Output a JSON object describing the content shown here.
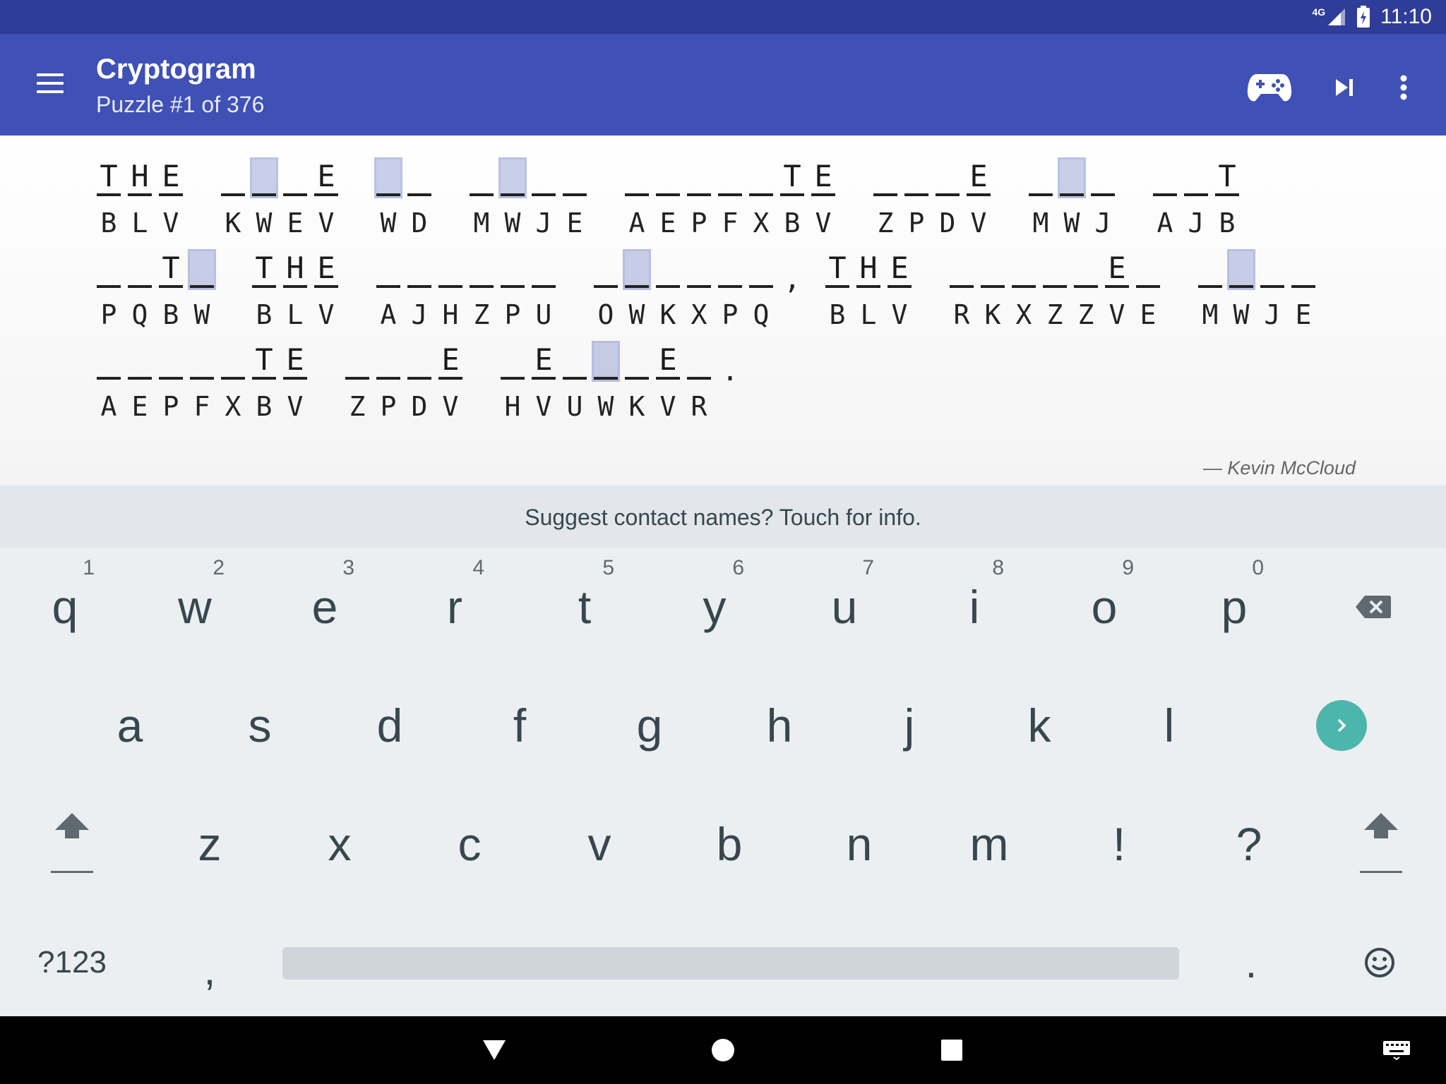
{
  "status": {
    "network": "4G",
    "time": "11:10"
  },
  "appbar": {
    "title": "Cryptogram",
    "subtitle": "Puzzle #1 of 376"
  },
  "puzzle": {
    "lines": [
      [
        {
          "cells": [
            {
              "g": "T",
              "c": "B"
            },
            {
              "g": "H",
              "c": "L"
            },
            {
              "g": "E",
              "c": "V"
            }
          ]
        },
        {
          "cells": [
            {
              "g": "",
              "c": "K"
            },
            {
              "g": "",
              "c": "W",
              "sel": true
            },
            {
              "g": "",
              "c": "E"
            },
            {
              "g": "E",
              "c": "V"
            }
          ]
        },
        {
          "cells": [
            {
              "g": "",
              "c": "W",
              "sel": true
            },
            {
              "g": "",
              "c": "D"
            }
          ]
        },
        {
          "cells": [
            {
              "g": "",
              "c": "M"
            },
            {
              "g": "",
              "c": "W",
              "sel": true
            },
            {
              "g": "",
              "c": "J"
            },
            {
              "g": "",
              "c": "E"
            }
          ]
        },
        {
          "cells": [
            {
              "g": "",
              "c": "A"
            },
            {
              "g": "",
              "c": "E"
            },
            {
              "g": "",
              "c": "P"
            },
            {
              "g": "",
              "c": "F"
            },
            {
              "g": "",
              "c": "X"
            },
            {
              "g": "T",
              "c": "B"
            },
            {
              "g": "E",
              "c": "V"
            }
          ]
        },
        {
          "cells": [
            {
              "g": "",
              "c": "Z"
            },
            {
              "g": "",
              "c": "P"
            },
            {
              "g": "",
              "c": "D"
            },
            {
              "g": "E",
              "c": "V"
            }
          ]
        },
        {
          "cells": [
            {
              "g": "",
              "c": "M"
            },
            {
              "g": "",
              "c": "W",
              "sel": true
            },
            {
              "g": "",
              "c": "J"
            }
          ]
        },
        {
          "cells": [
            {
              "g": "",
              "c": "A"
            },
            {
              "g": "",
              "c": "J"
            },
            {
              "g": "T",
              "c": "B"
            }
          ]
        }
      ],
      [
        {
          "cells": [
            {
              "g": "",
              "c": "P"
            },
            {
              "g": "",
              "c": "Q"
            },
            {
              "g": "T",
              "c": "B"
            },
            {
              "g": "",
              "c": "W",
              "sel": true
            }
          ]
        },
        {
          "cells": [
            {
              "g": "T",
              "c": "B"
            },
            {
              "g": "H",
              "c": "L"
            },
            {
              "g": "E",
              "c": "V"
            }
          ]
        },
        {
          "cells": [
            {
              "g": "",
              "c": "A"
            },
            {
              "g": "",
              "c": "J"
            },
            {
              "g": "",
              "c": "H"
            },
            {
              "g": "",
              "c": "Z"
            },
            {
              "g": "",
              "c": "P"
            },
            {
              "g": "",
              "c": "U"
            }
          ]
        },
        {
          "cells": [
            {
              "g": "",
              "c": "O"
            },
            {
              "g": "",
              "c": "W",
              "sel": true
            },
            {
              "g": "",
              "c": "K"
            },
            {
              "g": "",
              "c": "X"
            },
            {
              "g": "",
              "c": "P"
            },
            {
              "g": "",
              "c": "Q"
            }
          ],
          "punct": ","
        },
        {
          "cells": [
            {
              "g": "T",
              "c": "B"
            },
            {
              "g": "H",
              "c": "L"
            },
            {
              "g": "E",
              "c": "V"
            }
          ]
        },
        {
          "cells": [
            {
              "g": "",
              "c": "R"
            },
            {
              "g": "",
              "c": "K"
            },
            {
              "g": "",
              "c": "X"
            },
            {
              "g": "",
              "c": "Z"
            },
            {
              "g": "",
              "c": "Z"
            },
            {
              "g": "E",
              "c": "V"
            },
            {
              "g": "",
              "c": "E"
            }
          ]
        },
        {
          "cells": [
            {
              "g": "",
              "c": "M"
            },
            {
              "g": "",
              "c": "W",
              "sel": true
            },
            {
              "g": "",
              "c": "J"
            },
            {
              "g": "",
              "c": "E"
            }
          ]
        }
      ],
      [
        {
          "cells": [
            {
              "g": "",
              "c": "A"
            },
            {
              "g": "",
              "c": "E"
            },
            {
              "g": "",
              "c": "P"
            },
            {
              "g": "",
              "c": "F"
            },
            {
              "g": "",
              "c": "X"
            },
            {
              "g": "T",
              "c": "B"
            },
            {
              "g": "E",
              "c": "V"
            }
          ]
        },
        {
          "cells": [
            {
              "g": "",
              "c": "Z"
            },
            {
              "g": "",
              "c": "P"
            },
            {
              "g": "",
              "c": "D"
            },
            {
              "g": "E",
              "c": "V"
            }
          ]
        },
        {
          "cells": [
            {
              "g": "",
              "c": "H"
            },
            {
              "g": "E",
              "c": "V"
            },
            {
              "g": "",
              "c": "U"
            },
            {
              "g": "",
              "c": "W",
              "sel": true
            },
            {
              "g": "",
              "c": "K"
            },
            {
              "g": "E",
              "c": "V"
            },
            {
              "g": "",
              "c": "R"
            }
          ],
          "punct": "."
        }
      ]
    ],
    "author": "— Kevin McCloud"
  },
  "suggestion": "Suggest contact names? Touch for info.",
  "keyboard": {
    "row1": [
      {
        "k": "q",
        "h": "1"
      },
      {
        "k": "w",
        "h": "2"
      },
      {
        "k": "e",
        "h": "3"
      },
      {
        "k": "r",
        "h": "4"
      },
      {
        "k": "t",
        "h": "5"
      },
      {
        "k": "y",
        "h": "6"
      },
      {
        "k": "u",
        "h": "7"
      },
      {
        "k": "i",
        "h": "8"
      },
      {
        "k": "o",
        "h": "9"
      },
      {
        "k": "p",
        "h": "0"
      }
    ],
    "row2": [
      "a",
      "s",
      "d",
      "f",
      "g",
      "h",
      "j",
      "k",
      "l"
    ],
    "row3": [
      "z",
      "x",
      "c",
      "v",
      "b",
      "n",
      "m",
      "!",
      "?"
    ],
    "symbols_label": "?123",
    "comma": ",",
    "period": ".",
    "accent": "#4db6ac"
  },
  "icons": {
    "menu": "menu-icon",
    "gamepad": "gamepad-icon",
    "skip": "skip-next-icon",
    "overflow": "more-vert-icon",
    "backspace": "backspace-icon",
    "enter": "chevron-right-icon",
    "shift": "shift-icon",
    "emoji": "emoji-icon",
    "back": "back-icon",
    "home": "home-icon",
    "recents": "recents-icon",
    "ime": "keyboard-icon"
  }
}
